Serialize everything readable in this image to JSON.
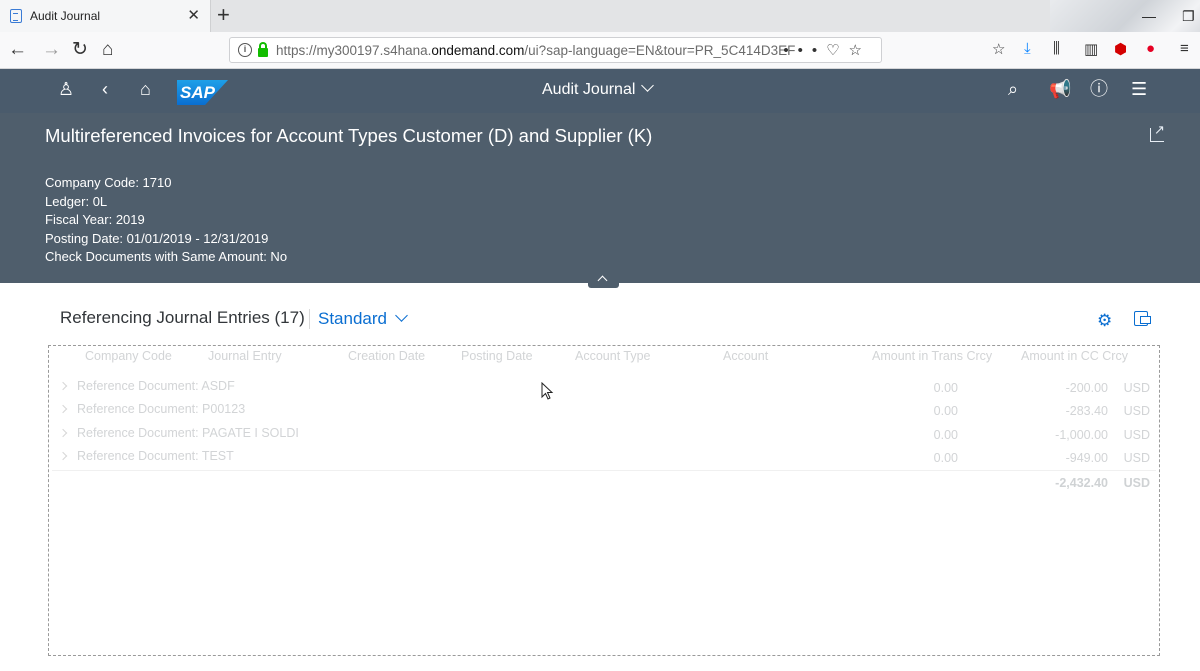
{
  "browser": {
    "tab_title": "Audit Journal",
    "url_prefix": "https://my300197.s4hana.",
    "url_domain": "ondemand.com",
    "url_rest": "/ui?sap-language=EN&tour=PR_5C414D3EF"
  },
  "shell": {
    "app_title": "Audit Journal",
    "logo": "SAP"
  },
  "header": {
    "title": "Multireferenced Invoices for Account Types Customer (D) and Supplier (K)",
    "attributes": [
      "Company Code: 1710",
      "Ledger: 0L",
      "Fiscal Year: 2019",
      "Posting Date: 01/01/2019 - 12/31/2019",
      "Check Documents with Same Amount: No"
    ]
  },
  "table": {
    "title": "Referencing Journal Entries (17)",
    "variant": "Standard",
    "columns": [
      "Company Code",
      "Journal Entry",
      "Creation Date",
      "Posting Date",
      "Account Type",
      "Account",
      "Amount in Trans Crcy",
      "Amount in CC Crcy"
    ],
    "rows": [
      {
        "reference": "Reference Document: ASDF",
        "trans_amount": "0.00",
        "cc_amount": "-200.00",
        "currency": "USD"
      },
      {
        "reference": "Reference Document: P00123",
        "trans_amount": "0.00",
        "cc_amount": "-283.40",
        "currency": "USD"
      },
      {
        "reference": "Reference Document: PAGATE I SOLDI",
        "trans_amount": "0.00",
        "cc_amount": "-1,000.00",
        "currency": "USD"
      },
      {
        "reference": "Reference Document: TEST",
        "trans_amount": "0.00",
        "cc_amount": "-949.00",
        "currency": "USD"
      }
    ],
    "total": {
      "cc_amount": "-2,432.40",
      "currency": "USD"
    }
  },
  "colors": {
    "shell_bg": "#4a5b6c",
    "header_bg": "#4f5e6c",
    "accent": "#0a6ed1",
    "faded_text": "#d2d4d6"
  }
}
